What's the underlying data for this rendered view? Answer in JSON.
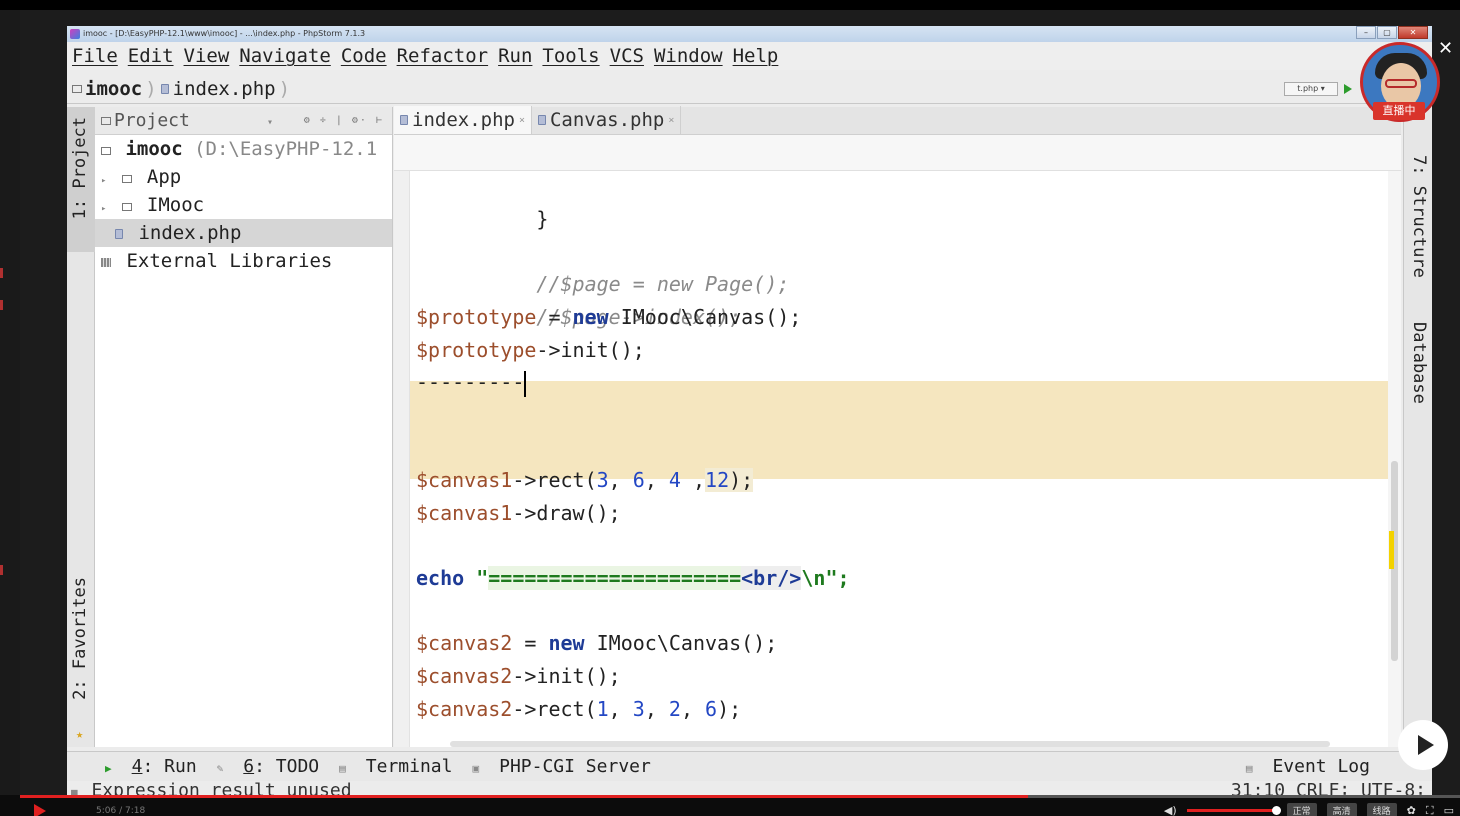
{
  "window": {
    "title": "imooc - [D:\\EasyPHP-12.1\\www\\imooc] - ...\\index.php - PhpStorm 7.1.3",
    "controls": [
      "–",
      "▢",
      "✕"
    ]
  },
  "menu": {
    "items": [
      "File",
      "Edit",
      "View",
      "Navigate",
      "Code",
      "Refactor",
      "Run",
      "Tools",
      "VCS",
      "Window",
      "Help"
    ]
  },
  "nav": {
    "crumbs": [
      "imooc",
      "index.php"
    ],
    "run_config": "t.php ▾"
  },
  "left_tools": {
    "project": "1: Project",
    "favorites": "2: Favorites"
  },
  "right_tools": {
    "structure": "7: Structure",
    "database": "Database"
  },
  "project": {
    "header": "Project",
    "dropdown": "▾",
    "tools": "⚙ ÷ | ⚙· ⊢",
    "tree": {
      "root": "imooc",
      "root_path": "(D:\\EasyPHP-12.1",
      "app": "App",
      "imooc_dir": "IMooc",
      "index_file": "index.php",
      "ext_libs": "External Libraries"
    }
  },
  "editor": {
    "tabs": [
      {
        "label": "index.php",
        "close": "×"
      },
      {
        "label": "Canvas.php",
        "close": "×"
      }
    ],
    "code": {
      "l0": "}",
      "l1": "//$page = new Page();",
      "l2": "//$page->index();",
      "l3_var": "$prototype",
      "l3_eq": " = ",
      "l3_kw": "new",
      "l3_rest": " IMooc\\Canvas();",
      "l4_var": "$prototype",
      "l4_rest": "->init();",
      "l5": "---------",
      "l6_var": "$canvas1",
      "l6_call": "->rect(",
      "l6_n1": "3",
      "l6_c1": ", ",
      "l6_n2": "6",
      "l6_c2": ", ",
      "l6_n3": "4",
      "l6_c3": " ,",
      "l6_n4": "12",
      "l6_end": ");",
      "l7_var": "$canvas1",
      "l7_rest": "->draw();",
      "l8_kw": "echo",
      "l8_q1": " \"",
      "l8_eq": "=====================",
      "l8_tag": "<br/>",
      "l8_nl": "\\n",
      "l8_q2": "\";",
      "l9_var": "$canvas2",
      "l9_eq": " = ",
      "l9_kw": "new",
      "l9_rest": " IMooc\\Canvas();",
      "l10_var": "$canvas2",
      "l10_rest": "->init();",
      "l11_var": "$canvas2",
      "l11_call": "->rect(",
      "l11_n1": "1",
      "l11_c1": ", ",
      "l11_n2": "3",
      "l11_c2": ", ",
      "l11_n3": "2",
      "l11_c3": ", ",
      "l11_n4": "6",
      "l11_end": ");"
    }
  },
  "bottom_tools": {
    "run_num": "4",
    "run_label": ": Run",
    "todo_num": "6",
    "todo_label": ": TODO",
    "terminal": "Terminal",
    "php_cgi": "PHP-CGI Server",
    "event_log": "Event Log"
  },
  "status": {
    "message": "Expression result unused",
    "position": "31:10  CRLF∶ UTF-8∶"
  },
  "player": {
    "live_badge": "直播中",
    "close": "✕",
    "time": "5:06 / 7:18",
    "progress": 0.7,
    "btn_normal": "正常",
    "btn_speed": "高清",
    "btn_line": "线路",
    "colors": {
      "accent": "#e02020",
      "live": "#d9342b"
    }
  }
}
